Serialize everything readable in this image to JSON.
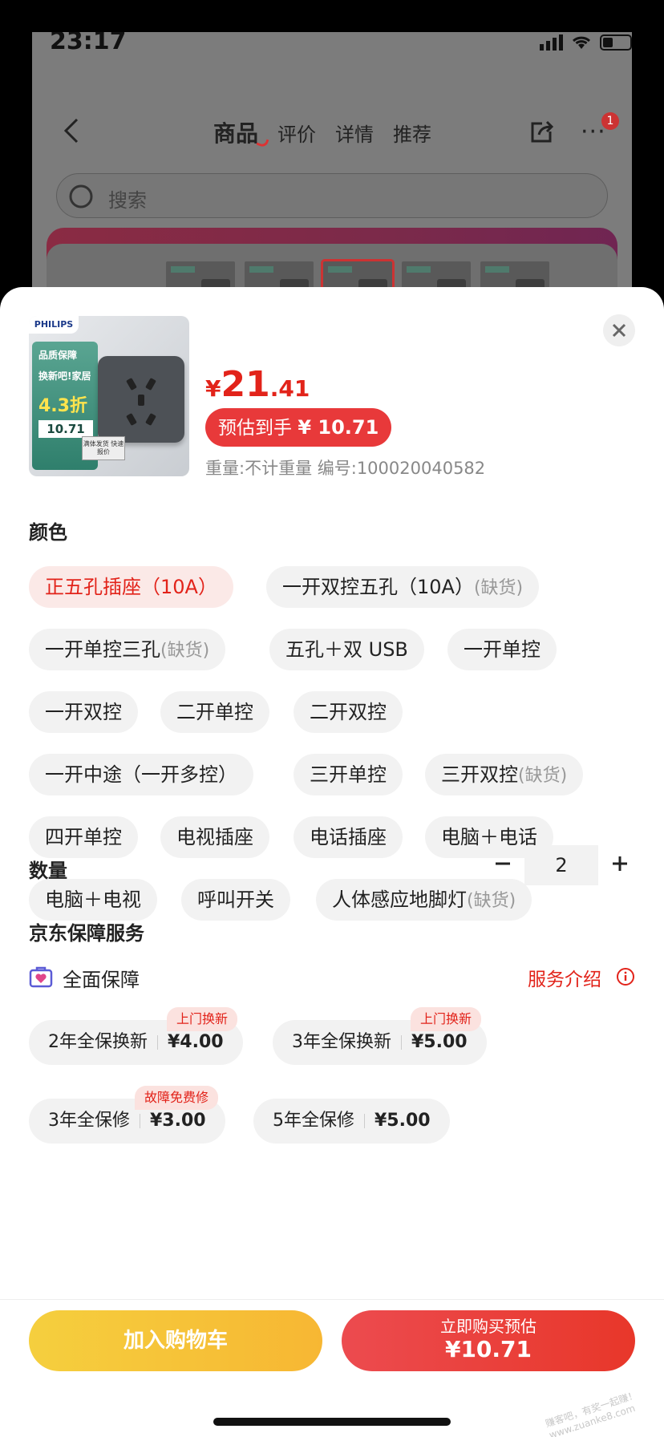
{
  "status": {
    "time": "23:17"
  },
  "nav": {
    "tabs": [
      "商品",
      "评价",
      "详情",
      "推荐"
    ],
    "badge": "1",
    "more": "···"
  },
  "search": {
    "placeholder": "搜索"
  },
  "product": {
    "brand_logo_text": "PHILIPS",
    "image_text": {
      "line1": "品质保障",
      "line2": "换新吧!家居",
      "discount": "4.3折",
      "price": "10.71",
      "stamp": "满体发货 快速报价"
    },
    "price_currency": "¥",
    "price_int": "21",
    "price_dec": ".41",
    "estimate_label": "预估到手",
    "estimate_price": "¥ 10.71",
    "meta": "重量:不计重量   编号:100020040582"
  },
  "color_section": {
    "title": "颜色",
    "out_of_stock_label": "(缺货)",
    "options": [
      {
        "label": "正五孔插座（10A）",
        "oos": ""
      },
      {
        "label": "一开双控五孔（10A）",
        "oos": "(缺货)"
      },
      {
        "label": "一开单控三孔",
        "oos": "(缺货)"
      },
      {
        "label": "五孔＋双 USB",
        "oos": ""
      },
      {
        "label": "一开单控",
        "oos": ""
      },
      {
        "label": "一开双控",
        "oos": ""
      },
      {
        "label": "二开单控",
        "oos": ""
      },
      {
        "label": "二开双控",
        "oos": ""
      },
      {
        "label": "一开中途（一开多控）",
        "oos": ""
      },
      {
        "label": "三开单控",
        "oos": ""
      },
      {
        "label": "三开双控",
        "oos": "(缺货)"
      },
      {
        "label": "四开单控",
        "oos": ""
      },
      {
        "label": "电视插座",
        "oos": ""
      },
      {
        "label": "电话插座",
        "oos": ""
      },
      {
        "label": "电脑＋电话",
        "oos": ""
      },
      {
        "label": "电脑＋电视",
        "oos": ""
      },
      {
        "label": "呼叫开关",
        "oos": ""
      },
      {
        "label": "人体感应地脚灯",
        "oos": "(缺货)"
      }
    ],
    "selected_index": 0
  },
  "quantity": {
    "title": "数量",
    "value": "2"
  },
  "service": {
    "title": "京东保障服务",
    "group_label": "全面保障",
    "intro_label": "服务介绍",
    "options": [
      {
        "name": "2年全保换新",
        "price": "¥4.00",
        "tag": "上门换新"
      },
      {
        "name": "3年全保换新",
        "price": "¥5.00",
        "tag": "上门换新"
      },
      {
        "name": "3年全保修",
        "price": "¥3.00",
        "tag": "故障免费修"
      },
      {
        "name": "5年全保修",
        "price": "¥5.00",
        "tag": ""
      }
    ]
  },
  "actions": {
    "add_cart": "加入购物车",
    "buy_line1": "立即购买预估",
    "buy_line2": "¥10.71"
  },
  "watermark": "赚客吧，有奖一起赚！\nwww.zuanke8.com",
  "colors": {
    "accent": "#e2231a",
    "cart": "#f6c23a",
    "buy": "#e8393a"
  }
}
